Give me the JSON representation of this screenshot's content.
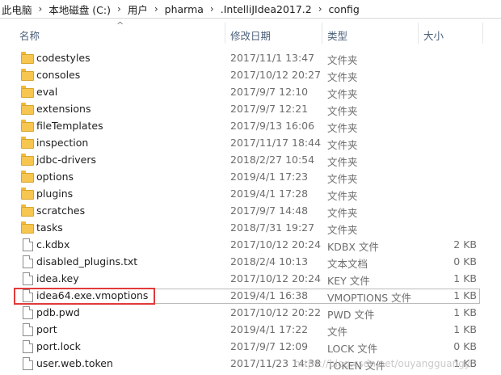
{
  "breadcrumb": [
    "此电脑",
    "本地磁盘 (C:)",
    "用户",
    "pharma",
    ".IntelliJIdea2017.2",
    "config"
  ],
  "columns": {
    "name": "名称",
    "date": "修改日期",
    "type": "类型",
    "size": "大小"
  },
  "files": [
    {
      "name": "codestyles",
      "date": "2017/11/1 13:47",
      "type": "文件夹",
      "size": "",
      "kind": "folder"
    },
    {
      "name": "consoles",
      "date": "2017/10/12 20:27",
      "type": "文件夹",
      "size": "",
      "kind": "folder"
    },
    {
      "name": "eval",
      "date": "2017/9/7 12:10",
      "type": "文件夹",
      "size": "",
      "kind": "folder"
    },
    {
      "name": "extensions",
      "date": "2017/9/7 12:21",
      "type": "文件夹",
      "size": "",
      "kind": "folder"
    },
    {
      "name": "fileTemplates",
      "date": "2017/9/13 16:06",
      "type": "文件夹",
      "size": "",
      "kind": "folder"
    },
    {
      "name": "inspection",
      "date": "2017/11/17 18:44",
      "type": "文件夹",
      "size": "",
      "kind": "folder"
    },
    {
      "name": "jdbc-drivers",
      "date": "2018/2/27 10:54",
      "type": "文件夹",
      "size": "",
      "kind": "folder"
    },
    {
      "name": "options",
      "date": "2019/4/1 17:23",
      "type": "文件夹",
      "size": "",
      "kind": "folder"
    },
    {
      "name": "plugins",
      "date": "2019/4/1 17:28",
      "type": "文件夹",
      "size": "",
      "kind": "folder"
    },
    {
      "name": "scratches",
      "date": "2017/9/7 14:48",
      "type": "文件夹",
      "size": "",
      "kind": "folder"
    },
    {
      "name": "tasks",
      "date": "2018/7/31 19:27",
      "type": "文件夹",
      "size": "",
      "kind": "folder"
    },
    {
      "name": "c.kdbx",
      "date": "2017/10/12 20:24",
      "type": "KDBX 文件",
      "size": "2 KB",
      "kind": "file"
    },
    {
      "name": "disabled_plugins.txt",
      "date": "2018/2/4 10:13",
      "type": "文本文档",
      "size": "0 KB",
      "kind": "file"
    },
    {
      "name": "idea.key",
      "date": "2017/10/12 20:24",
      "type": "KEY 文件",
      "size": "1 KB",
      "kind": "file"
    },
    {
      "name": "idea64.exe.vmoptions",
      "date": "2019/4/1 16:38",
      "type": "VMOPTIONS 文件",
      "size": "1 KB",
      "kind": "file"
    },
    {
      "name": "pdb.pwd",
      "date": "2017/10/12 20:22",
      "type": "PWD 文件",
      "size": "1 KB",
      "kind": "file"
    },
    {
      "name": "port",
      "date": "2019/4/1 17:22",
      "type": "文件",
      "size": "1 KB",
      "kind": "file"
    },
    {
      "name": "port.lock",
      "date": "2017/9/7 12:09",
      "type": "LOCK 文件",
      "size": "0 KB",
      "kind": "file"
    },
    {
      "name": "user.web.token",
      "date": "2017/11/23 14:38",
      "type": "TOKEN 文件",
      "size": "1 KB",
      "kind": "file"
    }
  ],
  "watermark": "https://blog.csdn.net/ouyangguangy",
  "colors": {
    "highlight": "#e23a3a",
    "folder": "#f7c650",
    "header_text": "#4c607a"
  }
}
